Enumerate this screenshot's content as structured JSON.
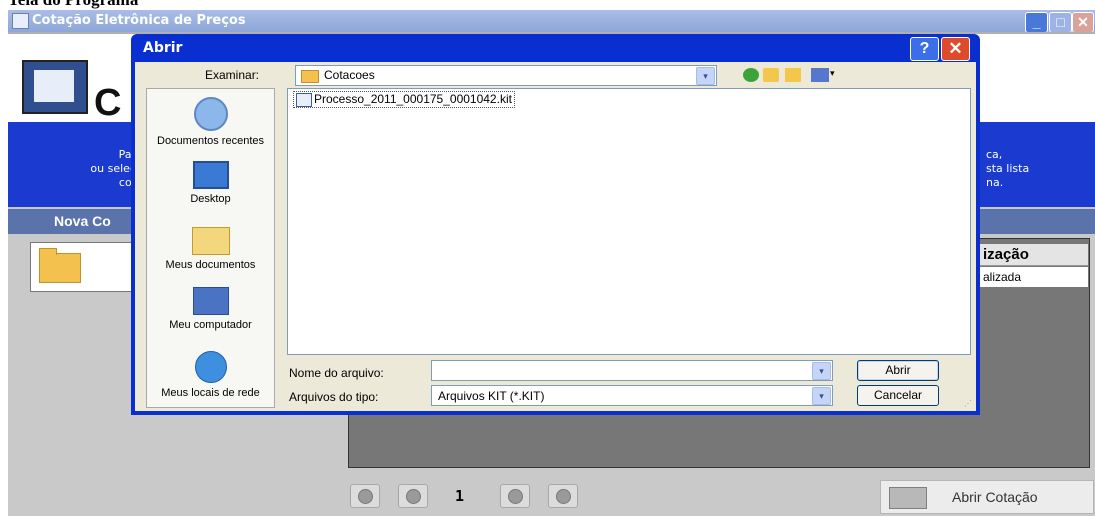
{
  "document": {
    "caption": "Tela do Programa"
  },
  "app": {
    "title": "Cotação Eletrônica de Preços",
    "header_title": "C",
    "band_left": [
      "Par",
      "ou selec",
      "cot"
    ],
    "band_right": [
      "ca,",
      "sta lista",
      "na."
    ],
    "nav_title": "Nova Co",
    "table_header": "ização",
    "table_cell": "alizada",
    "page_number": "1",
    "open_button": "Abrir Cotação",
    "help_glyph": "?"
  },
  "dialog": {
    "title": "Abrir",
    "help_label": "?",
    "close_label": "✕",
    "lookin_label": "Examinar:",
    "lookin_value": "Cotacoes",
    "dropdown_glyph": "▾",
    "views_arrow": "▾",
    "places": [
      {
        "icon": "recent-documents-icon",
        "label": "Documentos recentes"
      },
      {
        "icon": "desktop-icon",
        "label": "Desktop"
      },
      {
        "icon": "my-documents-icon",
        "label": "Meus documentos"
      },
      {
        "icon": "my-computer-icon",
        "label": "Meu computador"
      },
      {
        "icon": "network-places-icon",
        "label": "Meus locais de rede"
      }
    ],
    "files": [
      "Processo_2011_000175_0001042.kit"
    ],
    "filename_label": "Nome do arquivo:",
    "filename_value": "",
    "filetype_label": "Arquivos do tipo:",
    "filetype_value": "Arquivos KIT (*.KIT)",
    "open_label": "Abrir",
    "cancel_label": "Cancelar"
  }
}
